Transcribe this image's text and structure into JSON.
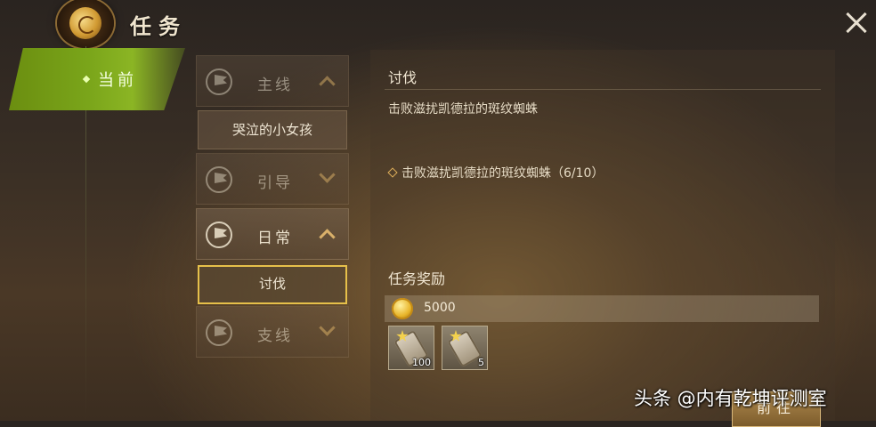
{
  "header": {
    "title": "任务"
  },
  "nav": {
    "current_label": "当前"
  },
  "categories": [
    {
      "label": "主线",
      "expanded": true,
      "dim": true,
      "sub": [
        "哭泣的小女孩"
      ]
    },
    {
      "label": "引导",
      "expanded": false,
      "dim": true,
      "sub": []
    },
    {
      "label": "日常",
      "expanded": true,
      "dim": false,
      "sub": [
        "讨伐"
      ]
    },
    {
      "label": "支线",
      "expanded": false,
      "dim": true,
      "sub": []
    }
  ],
  "selected_sub": "讨伐",
  "quest": {
    "title": "讨伐",
    "description": "击败滋扰凯德拉的斑纹蜘蛛",
    "objective": "击败滋扰凯德拉的斑纹蜘蛛（6/10）"
  },
  "rewards": {
    "title": "任务奖励",
    "gold": "5000",
    "items": [
      {
        "icon": "scroll-icon",
        "count": "100"
      },
      {
        "icon": "scroll-icon",
        "count": "5"
      }
    ]
  },
  "buttons": {
    "goto_label": "前往"
  },
  "watermark": "头条 @内有乾坤评测室"
}
